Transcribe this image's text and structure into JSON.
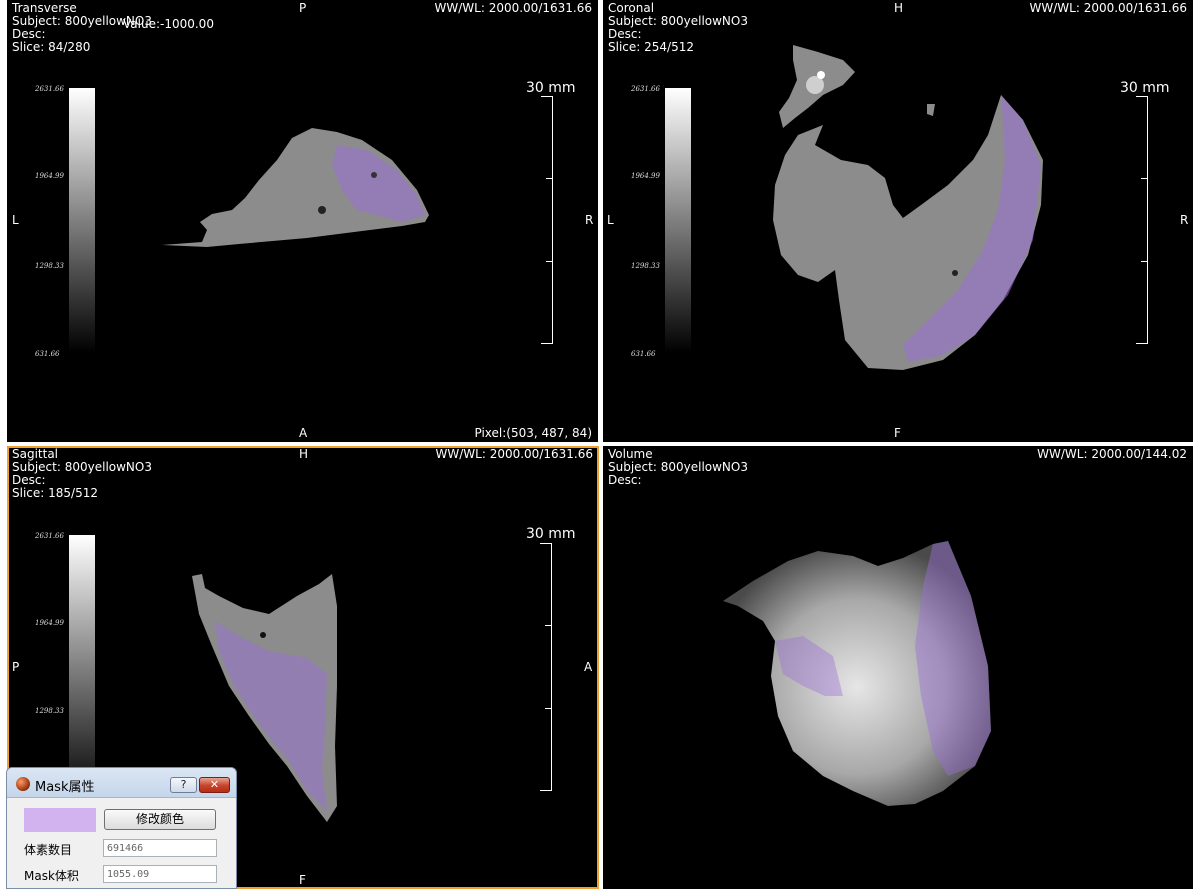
{
  "viewports": {
    "transverse": {
      "name": "Transverse",
      "subject": "Subject: 800yellowNO3",
      "desc": "Desc:",
      "slice": "Slice: 84/280",
      "value": "Value:-1000.00",
      "wwwl": "WW/WL: 2000.00/1631.66",
      "ori_top": "P",
      "ori_bottom": "A",
      "ori_left": "L",
      "ori_right": "R",
      "pixel": "Pixel:(503, 487, 84)",
      "scale_label": "30 mm",
      "colorbar_ticks": [
        "2631.66",
        "1964.99",
        "1298.33",
        "631.66"
      ]
    },
    "coronal": {
      "name": "Coronal",
      "subject": "Subject: 800yellowNO3",
      "desc": "Desc:",
      "slice": "Slice: 254/512",
      "wwwl": "WW/WL: 2000.00/1631.66",
      "ori_top": "H",
      "ori_bottom": "F",
      "ori_left": "L",
      "ori_right": "R",
      "scale_label": "30 mm",
      "colorbar_ticks": [
        "2631.66",
        "1964.99",
        "1298.33",
        "631.66"
      ]
    },
    "sagittal": {
      "name": "Sagittal",
      "subject": "Subject: 800yellowNO3",
      "desc": "Desc:",
      "slice": "Slice: 185/512",
      "wwwl": "WW/WL: 2000.00/1631.66",
      "ori_top": "H",
      "ori_bottom": "F",
      "ori_left": "P",
      "ori_right": "A",
      "scale_label": "30 mm",
      "colorbar_ticks": [
        "2631.66",
        "1964.99",
        "1298.33"
      ]
    },
    "volume": {
      "name": "Volume",
      "subject": "Subject: 800yellowNO3",
      "desc": "Desc:",
      "wwwl": "WW/WL: 2000.00/144.02"
    }
  },
  "mask_dialog": {
    "title": "Mask属性",
    "help_label": "?",
    "close_label": "✕",
    "mask_color": "#d3b3ef",
    "change_color_label": "修改颜色",
    "voxel_count_label": "体素数目",
    "voxel_count_value": "691466",
    "mask_volume_label": "Mask体积",
    "mask_volume_value": "1055.09"
  },
  "colors": {
    "active_border": "#f0a030",
    "mask_overlay": "#9a6fd6",
    "tissue": "#8c8c8c"
  }
}
